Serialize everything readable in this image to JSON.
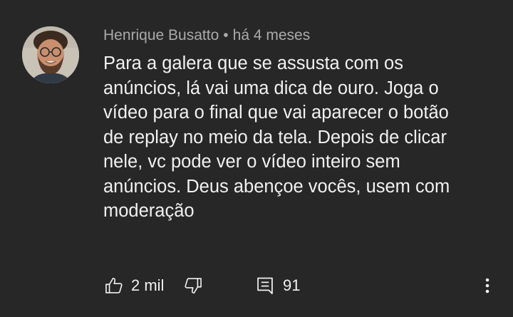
{
  "comment": {
    "author": "Henrique Busatto",
    "separator": "•",
    "time": "há 4 meses",
    "lines": [
      "Para a galera que se assusta com os",
      "anúncios, lá vai uma dica de ouro. Joga o",
      "vídeo para o final que vai aparecer o botão",
      "de replay no meio da tela. Depois de clicar",
      "nele, vc pode ver o vídeo inteiro sem",
      "anúncios. Deus abençoe vocês, usem com",
      "moderação"
    ],
    "avatar_icon": "user-avatar"
  },
  "actions": {
    "like_icon": "thumbs-up-icon",
    "like_count": "2 mil",
    "dislike_icon": "thumbs-down-icon",
    "reply_icon": "comment-icon",
    "reply_count": "91",
    "more_icon": "more-vert-icon"
  },
  "colors": {
    "background": "#272727",
    "text_primary": "#f1f1f1",
    "text_secondary": "#aaaaaa"
  }
}
